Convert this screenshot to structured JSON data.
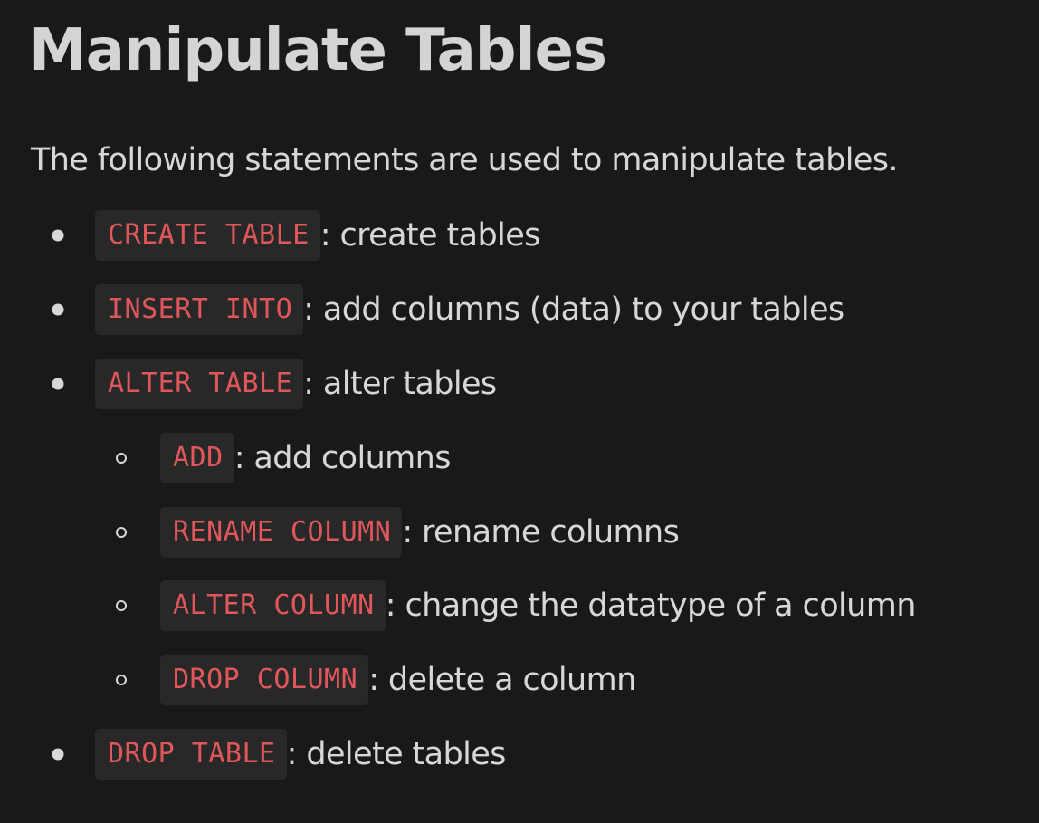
{
  "heading": "Manipulate Tables",
  "intro": "The following statements are used to manipulate tables.",
  "items": [
    {
      "code": "CREATE TABLE",
      "desc": ": create tables",
      "level": 1
    },
    {
      "code": "INSERT INTO",
      "desc": ": add columns (data) to your tables",
      "level": 1
    },
    {
      "code": "ALTER TABLE",
      "desc": ": alter tables",
      "level": 1
    },
    {
      "code": "ADD",
      "desc": ": add columns",
      "level": 2
    },
    {
      "code": "RENAME COLUMN",
      "desc": ": rename columns",
      "level": 2
    },
    {
      "code": "ALTER COLUMN",
      "desc": ": change the datatype of a column",
      "level": 2
    },
    {
      "code": "DROP COLUMN",
      "desc": ": delete a column",
      "level": 2
    },
    {
      "code": "DROP TABLE",
      "desc": ": delete tables",
      "level": 1
    }
  ],
  "colors": {
    "background": "#191919",
    "text": "#d7d7d7",
    "code_text": "#e0575b",
    "code_background": "#282828"
  }
}
